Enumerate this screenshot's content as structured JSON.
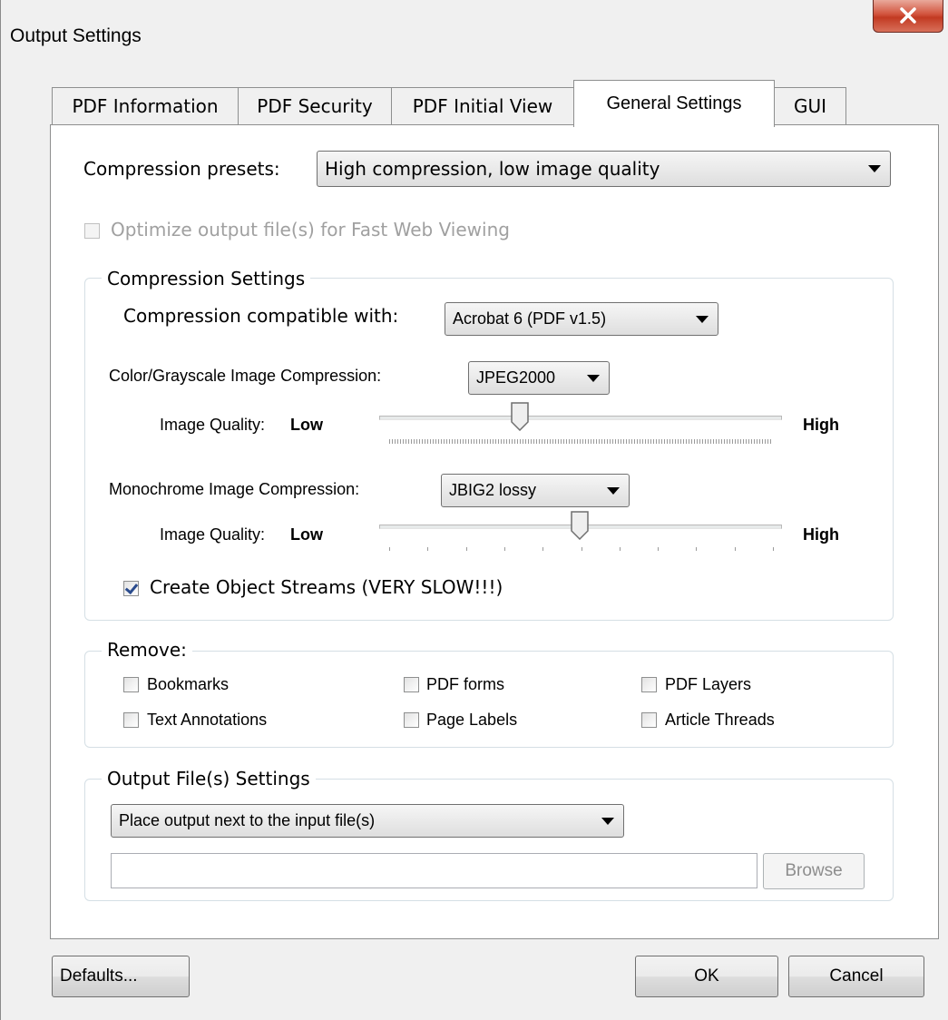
{
  "window": {
    "title": "Output Settings",
    "close_label": "X"
  },
  "tabs": [
    {
      "label": "PDF Information"
    },
    {
      "label": "PDF Security"
    },
    {
      "label": "PDF Initial View"
    },
    {
      "label": "General Settings",
      "active": true
    },
    {
      "label": "GUI"
    }
  ],
  "general": {
    "presets_label": "Compression presets:",
    "presets_value": "High compression, low image quality",
    "fast_web_label": "Optimize output file(s) for Fast Web Viewing",
    "fast_web_checked": false,
    "fast_web_enabled": false
  },
  "compression": {
    "group_label": "Compression Settings",
    "compatible_label": "Compression compatible with:",
    "compatible_value": "Acrobat 6 (PDF v1.5)",
    "color_label": "Color/Grayscale Image Compression:",
    "color_value": "JPEG2000",
    "color_quality_label": "Image Quality:",
    "color_quality_low": "Low",
    "color_quality_high": "High",
    "color_quality_level": 0.35,
    "mono_label": "Monochrome Image Compression:",
    "mono_value": "JBIG2 lossy",
    "mono_quality_label": "Image Quality:",
    "mono_quality_low": "Low",
    "mono_quality_high": "High",
    "mono_quality_level": 0.5,
    "object_streams_label": "Create Object Streams (VERY SLOW!!!)",
    "object_streams_checked": true
  },
  "remove": {
    "group_label": "Remove:",
    "bookmarks": "Bookmarks",
    "pdf_forms": "PDF forms",
    "pdf_layers": "PDF Layers",
    "text_annotations": "Text Annotations",
    "page_labels": "Page Labels",
    "article_threads": "Article Threads"
  },
  "output": {
    "group_label": "Output File(s) Settings",
    "location_value": "Place output next to the input file(s)",
    "path_value": "",
    "browse_label": "Browse"
  },
  "buttons": {
    "defaults": "Defaults...",
    "ok": "OK",
    "cancel": "Cancel"
  }
}
